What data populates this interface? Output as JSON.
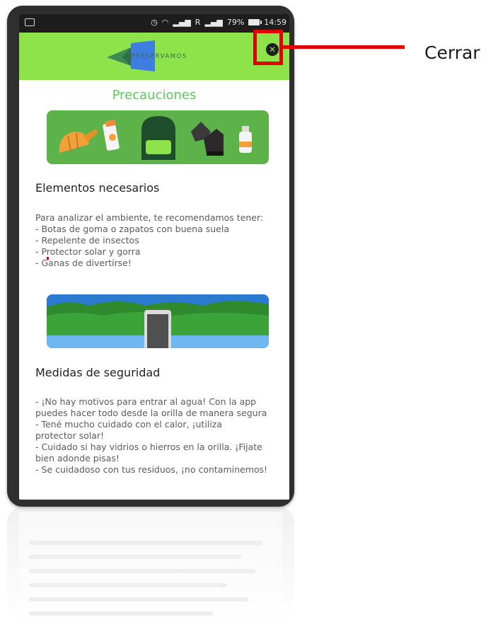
{
  "status_bar": {
    "signal_text": "R",
    "battery_percent": "79%",
    "time": "14:59"
  },
  "header": {
    "logo_text": "PRESERVAMOS",
    "close_icon": "close-circle-icon"
  },
  "title": "Precauciones",
  "section_required": {
    "heading": "Elementos necesarios",
    "lines": [
      "Para analizar el ambiente, te recomendamos tener:",
      "- Botas de goma o zapatos con buena suela",
      "- Repelente de insectos",
      "- Protector solar y gorra",
      "- Ganas de divertirse!"
    ]
  },
  "section_safety": {
    "heading": "Medidas de seguridad",
    "lines": [
      "- ¡No hay motivos para entrar al agua! Con la app",
      "puedes hacer todo desde la orilla de manera segura",
      "- Tené mucho cuidado con el calor, ¡utiliza",
      "protector solar!",
      "- Cuidado si hay vidrios o hierros en la orilla. ¡Fijate",
      "bien adonde pisas!",
      "- Se cuidadoso con tus residuos, ¡no contaminemos!"
    ]
  },
  "annotation": {
    "label": "Cerrar"
  },
  "colors": {
    "header_green": "#8ee34b",
    "title_green": "#5dc65d",
    "card_green": "#5db34a",
    "annotation_red": "#e00000"
  }
}
